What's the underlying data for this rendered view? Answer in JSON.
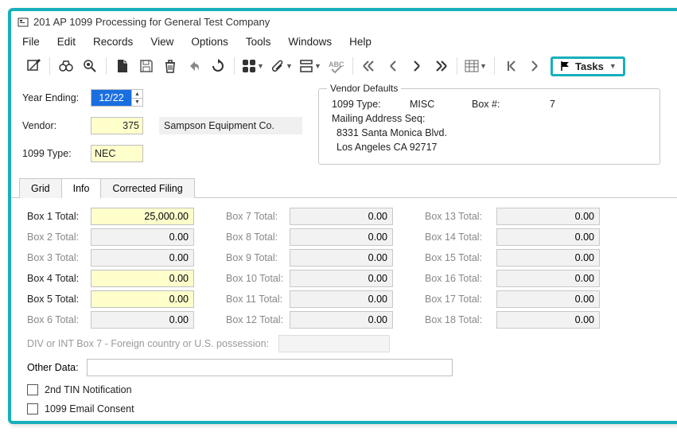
{
  "window": {
    "title": "201 AP 1099 Processing for General Test Company"
  },
  "menu": {
    "file": "File",
    "edit": "Edit",
    "records": "Records",
    "view": "View",
    "options": "Options",
    "tools": "Tools",
    "windows": "Windows",
    "help": "Help"
  },
  "toolbar": {
    "tasks_label": "Tasks"
  },
  "header": {
    "year_ending_label": "Year Ending:",
    "year_ending_value": "12/22",
    "vendor_label": "Vendor:",
    "vendor_value": "375",
    "vendor_name": "Sampson Equipment Co.",
    "type_label": "1099 Type:",
    "type_value": "NEC"
  },
  "defaults": {
    "legend": "Vendor Defaults",
    "type_label": "1099 Type:",
    "type_value": "MISC",
    "box_label": "Box #:",
    "box_value": "7",
    "mail_label": "Mailing Address Seq:",
    "addr1": "8331 Santa Monica Blvd.",
    "addr2": "Los Angeles CA 92717"
  },
  "tabs": {
    "grid": "Grid",
    "info": "Info",
    "corrected": "Corrected Filing"
  },
  "boxes": {
    "b1": {
      "label": "Box 1 Total:",
      "value": "25,000.00"
    },
    "b2": {
      "label": "Box 2 Total:",
      "value": "0.00"
    },
    "b3": {
      "label": "Box 3 Total:",
      "value": "0.00"
    },
    "b4": {
      "label": "Box 4 Total:",
      "value": "0.00"
    },
    "b5": {
      "label": "Box 5 Total:",
      "value": "0.00"
    },
    "b6": {
      "label": "Box 6 Total:",
      "value": "0.00"
    },
    "b7": {
      "label": "Box 7 Total:",
      "value": "0.00"
    },
    "b8": {
      "label": "Box 8 Total:",
      "value": "0.00"
    },
    "b9": {
      "label": "Box 9 Total:",
      "value": "0.00"
    },
    "b10": {
      "label": "Box 10 Total:",
      "value": "0.00"
    },
    "b11": {
      "label": "Box 11 Total:",
      "value": "0.00"
    },
    "b12": {
      "label": "Box 12 Total:",
      "value": "0.00"
    },
    "b13": {
      "label": "Box 13 Total:",
      "value": "0.00"
    },
    "b14": {
      "label": "Box 14 Total:",
      "value": "0.00"
    },
    "b15": {
      "label": "Box 15 Total:",
      "value": "0.00"
    },
    "b16": {
      "label": "Box 16 Total:",
      "value": "0.00"
    },
    "b17": {
      "label": "Box 17 Total:",
      "value": "0.00"
    },
    "b18": {
      "label": "Box 18 Total:",
      "value": "0.00"
    }
  },
  "footer": {
    "foreign_label": "DIV or INT Box 7 - Foreign country or U.S. possession:",
    "other_label": "Other Data:",
    "tin_label": "2nd TIN Notification",
    "consent_label": "1099 Email Consent"
  }
}
